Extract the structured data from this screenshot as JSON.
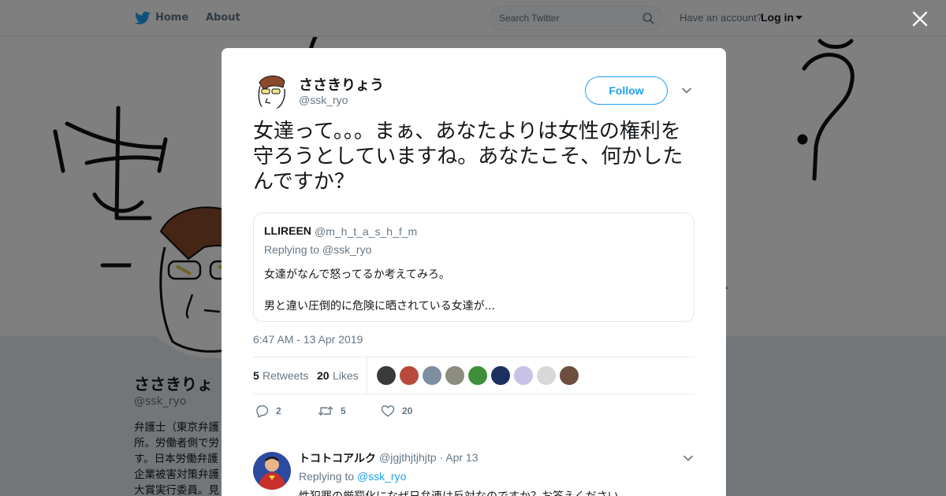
{
  "nav": {
    "home": "Home",
    "about": "About",
    "search_placeholder": "Search Twitter",
    "account_prompt": "Have an account?",
    "login": "Log in"
  },
  "background_profile": {
    "name": "ささきりょ",
    "handle": "@ssk_ryo",
    "bio_lines": [
      "弁護士（東京弁護",
      "所。労働者側で労",
      "す。日本労働弁護",
      "企業被害対策弁護",
      "大賞実行委員。見"
    ]
  },
  "tweet": {
    "author_name": "ささきりょう",
    "author_handle": "@ssk_ryo",
    "follow_label": "Follow",
    "text": "女達って。。。まぁ、あなたよりは女性の権利を守ろうとしていますね。あなたこそ、何かしたんですか？",
    "timestamp": "6:47 AM - 13 Apr 2019",
    "retweets": "5",
    "retweets_label": "Retweets",
    "likes": "20",
    "likes_label": "Likes",
    "liker_colors": [
      "#3a3a3a",
      "#b84a3c",
      "#7b8fa1",
      "#8c8c80",
      "#3f8f3a",
      "#1c2f5e",
      "#c9c2e6",
      "#d8d8d8",
      "#6f4e42"
    ],
    "action_reply_count": "2",
    "action_retweet_count": "5",
    "action_like_count": "20"
  },
  "quote": {
    "name": "LLIREEN",
    "handle": "@m_h_t_a_s_h_f_m",
    "replying_to": "Replying to @ssk_ryo",
    "line1": "女達がなんで怒ってるか考えてみろ。",
    "line2": "男と違い圧倒的に危険に晒されている女達が..."
  },
  "reply": {
    "name": "トコトコアルク",
    "handle_date": "@jgjthjtjhjtp · Apr 13",
    "replying_prefix": "Replying to",
    "replying_handle": "@ssk_ryo",
    "text": "性犯罪の厳罰化になぜ日弁連は反対なのですか？お答えください"
  },
  "colors": {
    "accent": "#1da1f2",
    "muted": "#657786",
    "text": "#14171a"
  }
}
